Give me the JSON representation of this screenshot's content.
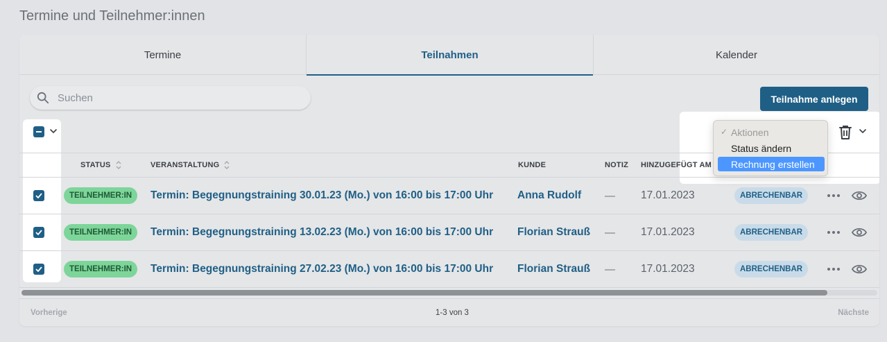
{
  "page": {
    "title": "Termine und Teilnehmer:innen"
  },
  "tabs": [
    {
      "label": "Termine",
      "active": false
    },
    {
      "label": "Teilnahmen",
      "active": true
    },
    {
      "label": "Kalender",
      "active": false
    }
  ],
  "search": {
    "placeholder": "Suchen",
    "value": ""
  },
  "toolbar": {
    "create_label": "Teilnahme anlegen"
  },
  "actions_menu": {
    "options": [
      "Aktionen",
      "Status ändern",
      "Rechnung erstellen"
    ],
    "checked": "Aktionen",
    "highlighted": "Rechnung erstellen"
  },
  "table": {
    "columns": {
      "status": "STATUS",
      "veranstaltung": "VERANSTALTUNG",
      "kunde": "KUNDE",
      "notiz": "NOTIZ",
      "hinzugefuegt": "HINZUGEFÜGT AM"
    },
    "rows": [
      {
        "checked": true,
        "status": "TEILNEHMER:IN",
        "veranstaltung": "Termin: Begegnungstraining 30.01.23 (Mo.) von 16:00 bis 17:00 Uhr",
        "kunde": "Anna Rudolf",
        "notiz": "—",
        "datum": "17.01.2023",
        "abrechnung": "ABRECHENBAR"
      },
      {
        "checked": true,
        "status": "TEILNEHMER:IN",
        "veranstaltung": "Termin: Begegnungstraining 13.02.23 (Mo.) von 16:00 bis 17:00 Uhr",
        "kunde": "Florian Strauß",
        "notiz": "—",
        "datum": "17.01.2023",
        "abrechnung": "ABRECHENBAR"
      },
      {
        "checked": true,
        "status": "TEILNEHMER:IN",
        "veranstaltung": "Termin: Begegnungstraining 27.02.23 (Mo.) von 16:00 bis 17:00 Uhr",
        "kunde": "Florian Strauß",
        "notiz": "—",
        "datum": "17.01.2023",
        "abrechnung": "ABRECHENBAR"
      }
    ]
  },
  "pagination": {
    "prev": "Vorherige",
    "info": "1-3 von 3",
    "next": "Nächste"
  },
  "colors": {
    "primary": "#1f5f86",
    "status_green": "#7dd59a",
    "billable_bg": "#c9dbe9",
    "menu_highlight": "#4c97ff"
  }
}
